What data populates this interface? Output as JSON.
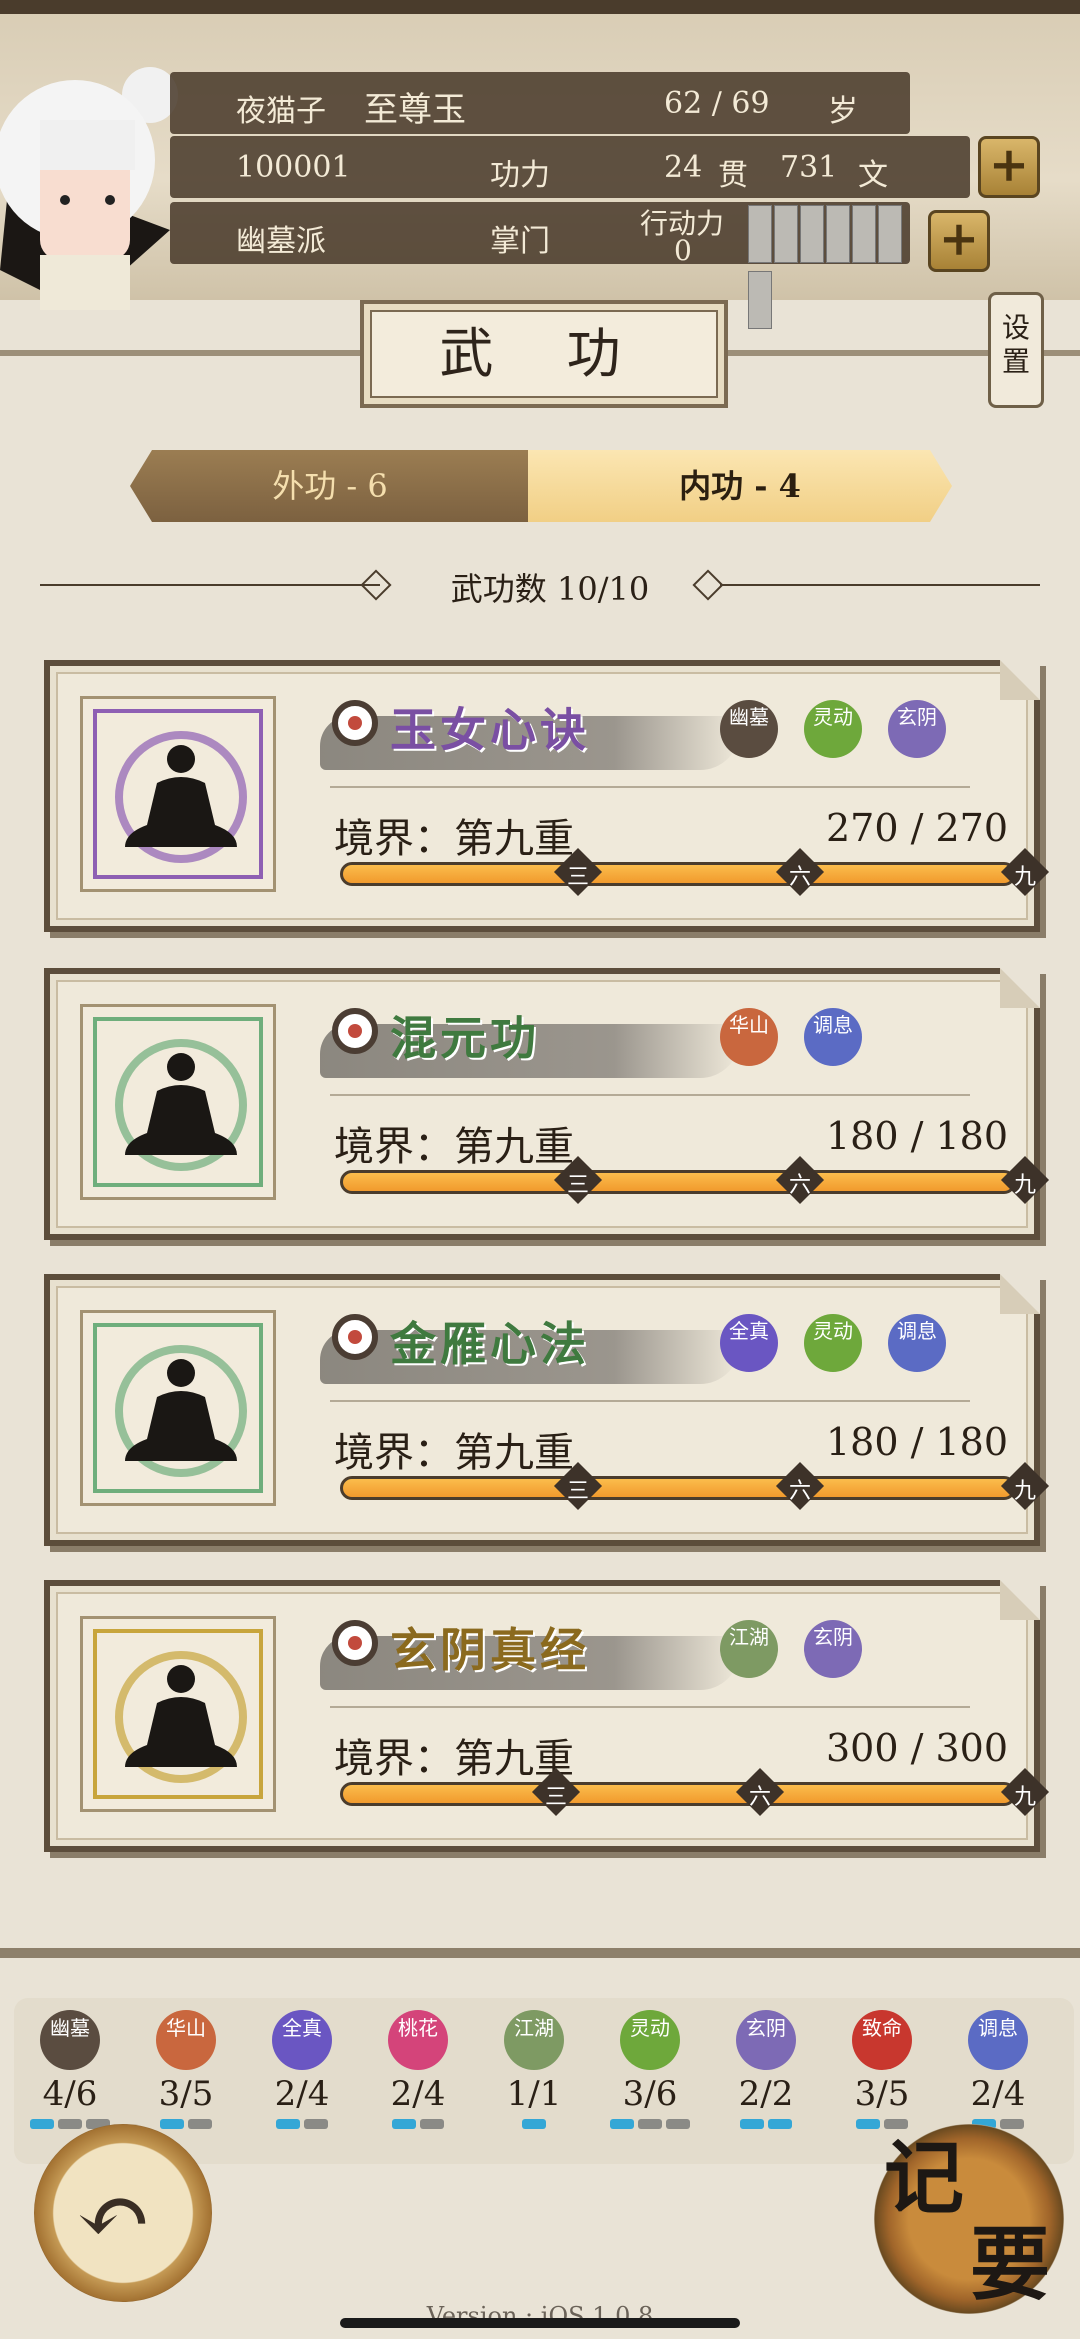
{
  "header": {
    "player_tag": "夜猫子",
    "player_name": "至尊玉",
    "age": "62 / 69",
    "age_unit": "岁",
    "player_id": "100001",
    "power_label": "功力",
    "money_guan": "24",
    "money_guan_unit": "贯",
    "money_wen": "731",
    "money_wen_unit": "文",
    "sect": "幽墓派",
    "rank": "掌门",
    "action_label": "行动力",
    "action_value": "0",
    "add_icon": "plus-icon"
  },
  "page_title": "武 功",
  "settings_label": "设置",
  "tabs": {
    "outer": "外功 - 6",
    "inner": "内功 - 4",
    "active": "inner"
  },
  "skill_count": "武功数 10/10",
  "skills": [
    {
      "name": "玉女心诀",
      "name_color": "#7a4fa3",
      "ring_color": "#8e5fb3",
      "tags": [
        {
          "text": "幽墓",
          "color": "#5a4c40"
        },
        {
          "text": "灵动",
          "color": "#6ea83b"
        },
        {
          "text": "玄阴",
          "color": "#7d6ab5"
        }
      ],
      "realm": "境界：第九重",
      "points": "270 / 270"
    },
    {
      "name": "混元功",
      "name_color": "#3f7a3f",
      "ring_color": "#6fae7c",
      "tags": [
        {
          "text": "华山",
          "color": "#c9673e"
        },
        {
          "text": "调息",
          "color": "#5b6bc4"
        }
      ],
      "realm": "境界：第九重",
      "points": "180 / 180"
    },
    {
      "name": "金雁心法",
      "name_color": "#3f7a3f",
      "ring_color": "#6fae7c",
      "tags": [
        {
          "text": "全真",
          "color": "#6a56c2"
        },
        {
          "text": "灵动",
          "color": "#6ea83b"
        },
        {
          "text": "调息",
          "color": "#5b6bc4"
        }
      ],
      "realm": "境界：第九重",
      "points": "180 / 180"
    },
    {
      "name": "玄阴真经",
      "name_color": "#8b6a1e",
      "ring_color": "#c8a53c",
      "tags": [
        {
          "text": "江湖",
          "color": "#7e9a63"
        },
        {
          "text": "玄阴",
          "color": "#7d6ab5"
        }
      ],
      "realm": "境界：第九重",
      "points": "300 / 300"
    }
  ],
  "bar_marks": [
    "三",
    "六",
    "九"
  ],
  "schools": [
    {
      "label": "幽墓",
      "value": "4/6",
      "color": "#5a4c40",
      "pips": 3,
      "on": 1
    },
    {
      "label": "华山",
      "value": "3/5",
      "color": "#c9673e",
      "pips": 2,
      "on": 1
    },
    {
      "label": "全真",
      "value": "2/4",
      "color": "#6a56c2",
      "pips": 2,
      "on": 1
    },
    {
      "label": "桃花",
      "value": "2/4",
      "color": "#d4447a",
      "pips": 2,
      "on": 1
    },
    {
      "label": "江湖",
      "value": "1/1",
      "color": "#7e9a63",
      "pips": 1,
      "on": 1
    },
    {
      "label": "灵动",
      "value": "3/6",
      "color": "#6ea83b",
      "pips": 3,
      "on": 1
    },
    {
      "label": "玄阴",
      "value": "2/2",
      "color": "#7d6ab5",
      "pips": 2,
      "on": 2
    },
    {
      "label": "致命",
      "value": "3/5",
      "color": "#c8372e",
      "pips": 2,
      "on": 1
    },
    {
      "label": "调息",
      "value": "2/4",
      "color": "#5b6bc4",
      "pips": 2,
      "on": 1
    }
  ],
  "back_icon": "back-arrow-icon",
  "memo_button": {
    "line1": "记",
    "line2": "要"
  },
  "version": "Version : iOS 1.0.8"
}
